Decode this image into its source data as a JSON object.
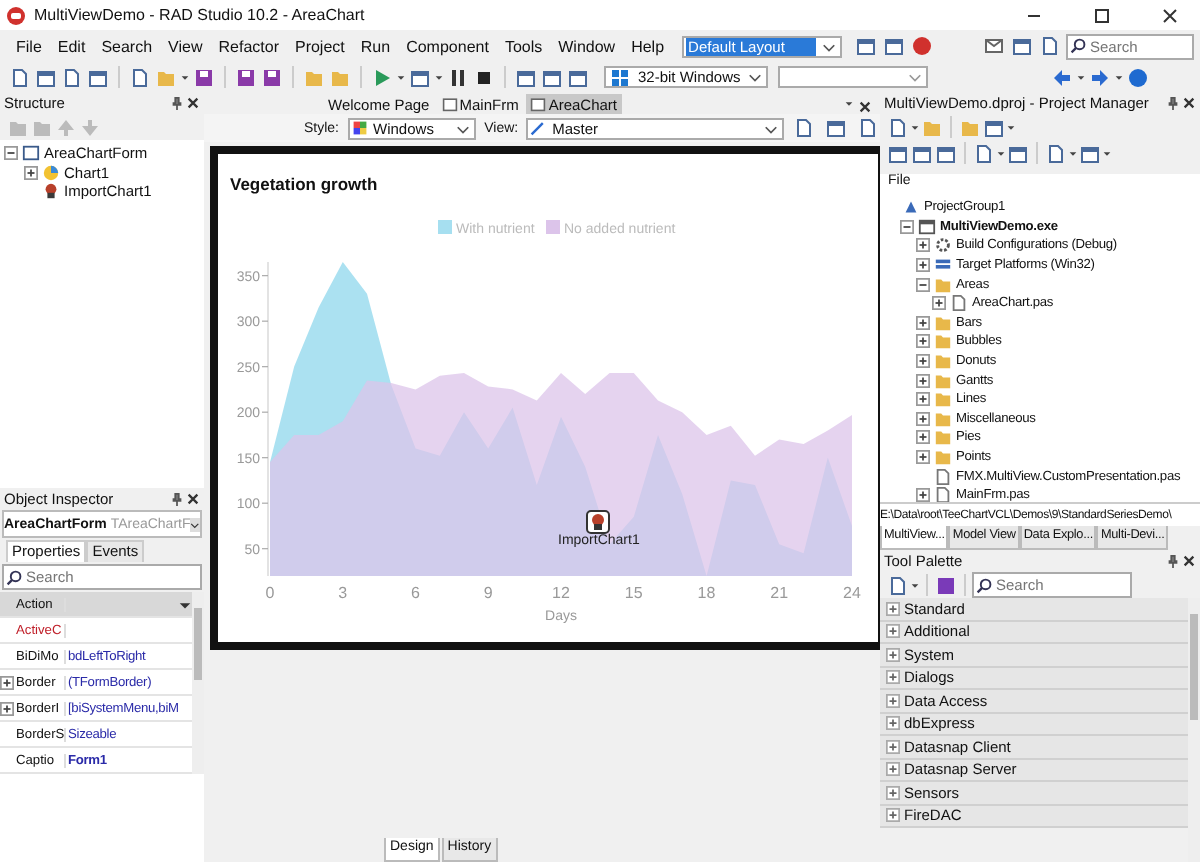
{
  "window": {
    "title": "MultiViewDemo - RAD Studio 10.2 - AreaChart"
  },
  "menu": [
    "File",
    "Edit",
    "Search",
    "View",
    "Refactor",
    "Project",
    "Run",
    "Component",
    "Tools",
    "Window",
    "Help"
  ],
  "layout_combo": {
    "value": "Default Layout"
  },
  "search": {
    "placeholder": "Search"
  },
  "platform_combo": {
    "value": "32-bit Windows"
  },
  "structure": {
    "title": "Structure",
    "tree": [
      {
        "label": "AreaChartForm",
        "kind": "form",
        "expanded": true,
        "children": [
          {
            "label": "Chart1",
            "kind": "chart",
            "expanded": false
          },
          {
            "label": "ImportChart1",
            "kind": "component"
          }
        ]
      }
    ]
  },
  "object_inspector": {
    "title": "Object Inspector",
    "object_name": "AreaChartForm",
    "object_type": "TAreaChartF",
    "tabs": [
      {
        "label": "Properties",
        "selected": true
      },
      {
        "label": "Events",
        "selected": false
      }
    ],
    "search": {
      "placeholder": "Search"
    },
    "properties": [
      {
        "name": "Action",
        "kind": "plain",
        "selected": true
      },
      {
        "name": "ActiveC",
        "kind": "reference",
        "selected": false
      },
      {
        "name": "BiDiMo",
        "value": "bdLeftToRight",
        "kind": "plain",
        "selected": false
      },
      {
        "name": "Border",
        "value": "(TFormBorder)",
        "kind": "plain",
        "expanded": false,
        "selected": false
      },
      {
        "name": "BorderI",
        "value": "[biSystemMenu,biM",
        "kind": "plain",
        "expanded": false,
        "selected": false
      },
      {
        "name": "BorderS",
        "value": "Sizeable",
        "kind": "plain",
        "selected": false
      },
      {
        "name": "Captio",
        "value": "Form1",
        "kind": "modified",
        "selected": false
      }
    ]
  },
  "editor_tabs": [
    {
      "label": "Welcome Page",
      "selected": false
    },
    {
      "label": "MainFrm",
      "selected": false
    },
    {
      "label": "AreaChart",
      "selected": true
    }
  ],
  "designer": {
    "style": {
      "label": "Style:",
      "value": "Windows"
    },
    "view": {
      "label": "View:",
      "value": "Master"
    }
  },
  "form": {
    "component_label": "ImportChart1",
    "chart_data": {
      "type": "area",
      "title": "Vegetation growth",
      "xlabel": "Days",
      "x": [
        0,
        1,
        2,
        3,
        4,
        5,
        6,
        7,
        8,
        9,
        10,
        11,
        12,
        13,
        14,
        15,
        16,
        17,
        18,
        19,
        20,
        21,
        22,
        23,
        24
      ],
      "series": [
        {
          "name": "With nutrient",
          "color": "#a6dff0",
          "values": [
            145,
            250,
            315,
            365,
            330,
            230,
            160,
            152,
            200,
            160,
            205,
            120,
            195,
            140,
            55,
            85,
            175,
            110,
            20,
            125,
            120,
            55,
            45,
            150,
            75
          ]
        },
        {
          "name": "No added nutrient",
          "color": "#dcc4ea",
          "values": [
            145,
            175,
            175,
            190,
            235,
            232,
            225,
            240,
            243,
            228,
            225,
            213,
            243,
            220,
            243,
            243,
            213,
            200,
            175,
            185,
            152,
            170,
            165,
            180,
            197
          ]
        }
      ],
      "xlim": [
        0,
        24
      ],
      "ylim": [
        20,
        365
      ],
      "legend": true,
      "xticks": [
        0,
        3,
        6,
        9,
        12,
        15,
        18,
        21,
        24
      ],
      "yticks": [
        50,
        100,
        150,
        200,
        250,
        300,
        350
      ]
    }
  },
  "bottom_tabs": [
    {
      "label": "Design",
      "selected": true
    },
    {
      "label": "History",
      "selected": false
    }
  ],
  "project_manager": {
    "title": "MultiViewDemo.dproj - Project Manager",
    "column_header": "File",
    "tree": [
      {
        "label": "ProjectGroup1",
        "kind": "group",
        "children": [
          {
            "label": "MultiViewDemo.exe",
            "kind": "project",
            "expanded": true,
            "children": [
              {
                "label": "Build Configurations (Debug)",
                "kind": "config",
                "expanded": false
              },
              {
                "label": "Target Platforms (Win32)",
                "kind": "platforms",
                "expanded": false
              },
              {
                "label": "Areas",
                "kind": "folder",
                "expanded": true,
                "children": [
                  {
                    "label": "AreaChart.pas",
                    "kind": "file",
                    "expanded": false
                  }
                ]
              },
              {
                "label": "Bars",
                "kind": "folder",
                "expanded": false
              },
              {
                "label": "Bubbles",
                "kind": "folder",
                "expanded": false
              },
              {
                "label": "Donuts",
                "kind": "folder",
                "expanded": false
              },
              {
                "label": "Gantts",
                "kind": "folder",
                "expanded": false
              },
              {
                "label": "Lines",
                "kind": "folder",
                "expanded": false
              },
              {
                "label": "Miscellaneous",
                "kind": "folder",
                "expanded": false
              },
              {
                "label": "Pies",
                "kind": "folder",
                "expanded": false
              },
              {
                "label": "Points",
                "kind": "folder",
                "expanded": false
              },
              {
                "label": "FMX.MultiView.CustomPresentation.pas",
                "kind": "file"
              },
              {
                "label": "MainFrm.pas",
                "kind": "file",
                "expanded": false
              }
            ]
          }
        ]
      }
    ],
    "path": "E:\\Data\\root\\TeeChartVCL\\Demos\\9\\StandardSeriesDemo\\",
    "tabs": [
      {
        "label": "MultiView...",
        "selected": true
      },
      {
        "label": "Model View",
        "selected": false
      },
      {
        "label": "Data Explo...",
        "selected": false
      },
      {
        "label": "Multi-Devi...",
        "selected": false
      }
    ]
  },
  "tool_palette": {
    "title": "Tool Palette",
    "search": {
      "placeholder": "Search"
    },
    "categories": [
      "Standard",
      "Additional",
      "System",
      "Dialogs",
      "Data Access",
      "dbExpress",
      "Datasnap Client",
      "Datasnap Server",
      "Sensors",
      "FireDAC"
    ]
  }
}
